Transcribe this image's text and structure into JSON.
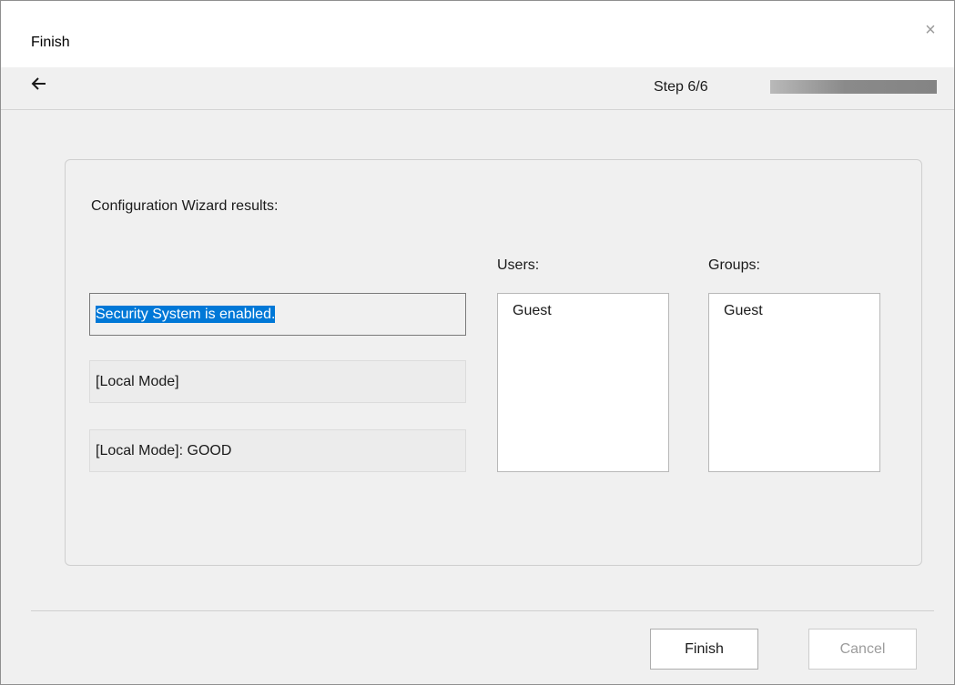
{
  "window": {
    "title": "Finish",
    "close_glyph": "×"
  },
  "stepbar": {
    "back_icon": "arrow-left-icon",
    "step_label": "Step 6/6",
    "progress_fraction": 1.0
  },
  "main": {
    "results_label": "Configuration Wizard results:",
    "status_fields": [
      "Security System is enabled.",
      "[Local Mode]",
      "[Local Mode]: GOOD"
    ],
    "users_label": "Users:",
    "users": [
      "Guest"
    ],
    "groups_label": "Groups:",
    "groups": [
      "Guest"
    ]
  },
  "footer": {
    "finish_label": "Finish",
    "cancel_label": "Cancel"
  },
  "colors": {
    "selection": "#0078d7",
    "progress": "#848484"
  }
}
